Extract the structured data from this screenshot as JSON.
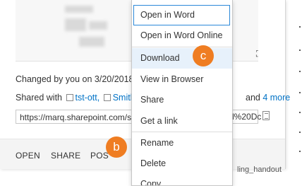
{
  "card": {
    "changed_text": "Changed by you on 3/20/2018",
    "shared_prefix": "Shared with",
    "shared_user_1": "tst-ott,",
    "shared_user_2": "Smith,",
    "shared_more": "4 more",
    "url_value": "https://marq.sharepoint.com/s",
    "url_tail": "d%20Dc",
    "actions": [
      "OPEN",
      "SHARE",
      "POS"
    ],
    "handout_text": "ling_handout"
  },
  "menu": {
    "items": [
      "Open in Word",
      "Open in Word Online",
      "Download",
      "View in Browser",
      "Share",
      "Get a link",
      "Rename",
      "Delete",
      "Copy"
    ],
    "focused_index": 0,
    "hover_index": 2
  },
  "markers": {
    "b": "b",
    "c": "c",
    "color": "#ef7d22"
  },
  "icons": {
    "expand": "expand-icon",
    "copy": "copy-icon",
    "checkbox": "checkbox-icon"
  },
  "colors": {
    "link": "#0072c6",
    "focus_border": "#2b88d8",
    "hover_bg": "#e7f1fb"
  }
}
